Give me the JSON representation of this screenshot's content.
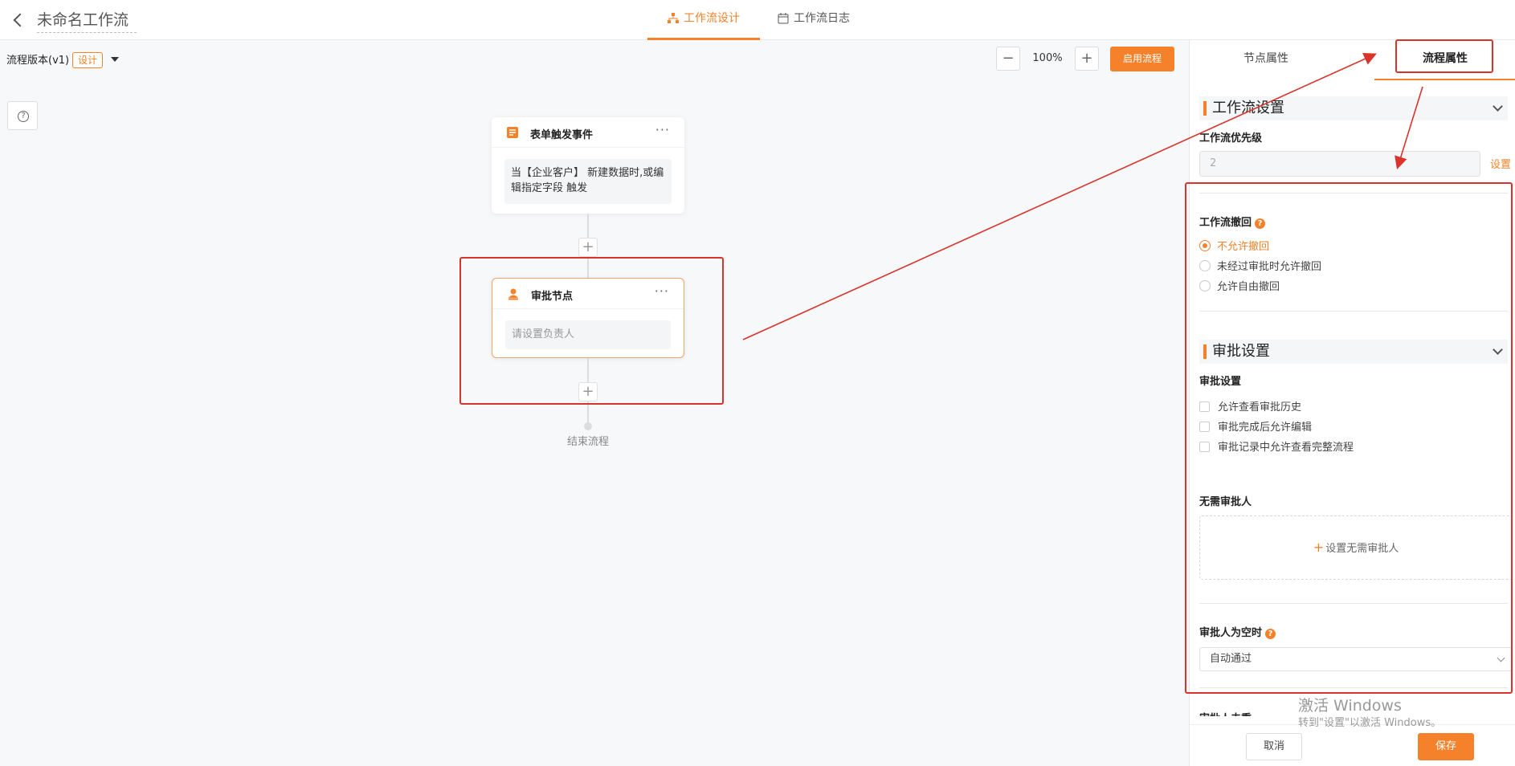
{
  "header": {
    "title": "未命名工作流",
    "tabs": [
      {
        "label": "工作流设计",
        "active": true
      },
      {
        "label": "工作流日志",
        "active": false
      }
    ]
  },
  "canvas": {
    "version_label": "流程版本(v1)",
    "version_badge": "设计",
    "zoom": "100%",
    "zoom_minus": "−",
    "zoom_plus": "+",
    "enable_button": "启用流程",
    "help_icon": "question-icon",
    "nodes": [
      {
        "title": "表单触发事件",
        "body": "当【企业客户】 新建数据时,或编辑指定字段 触发",
        "icon": "form-icon"
      },
      {
        "title": "审批节点",
        "body": "请设置负责人",
        "icon": "approver-icon"
      }
    ],
    "more": "···",
    "add": "+",
    "end_label": "结束流程"
  },
  "panel": {
    "tabs": [
      {
        "label": "节点属性",
        "active": false
      },
      {
        "label": "流程属性",
        "active": true
      }
    ],
    "workflow_section": "工作流设置",
    "priority_label": "工作流优先级",
    "priority_value": "2",
    "priority_set": "设置",
    "withdraw_label": "工作流撤回",
    "withdraw_options": [
      "不允许撤回",
      "未经过审批时允许撤回",
      "允许自由撤回"
    ],
    "withdraw_selected": 0,
    "approval_section": "审批设置",
    "approval_label": "审批设置",
    "approval_options": [
      "允许查看审批历史",
      "审批完成后允许编辑",
      "审批记录中允许查看完整流程"
    ],
    "no_approver_label": "无需审批人",
    "no_approver_add": "设置无需审批人",
    "empty_approver_label": "审批人为空时",
    "empty_approver_value": "自动通过",
    "cutoff_label": "审批人去重",
    "cancel": "取消",
    "save": "保存"
  },
  "watermark": {
    "line1": "激活 Windows",
    "line2": "转到\"设置\"以激活 Windows。"
  },
  "colors": {
    "accent": "#f5822a",
    "annotation": "#d9342b"
  }
}
